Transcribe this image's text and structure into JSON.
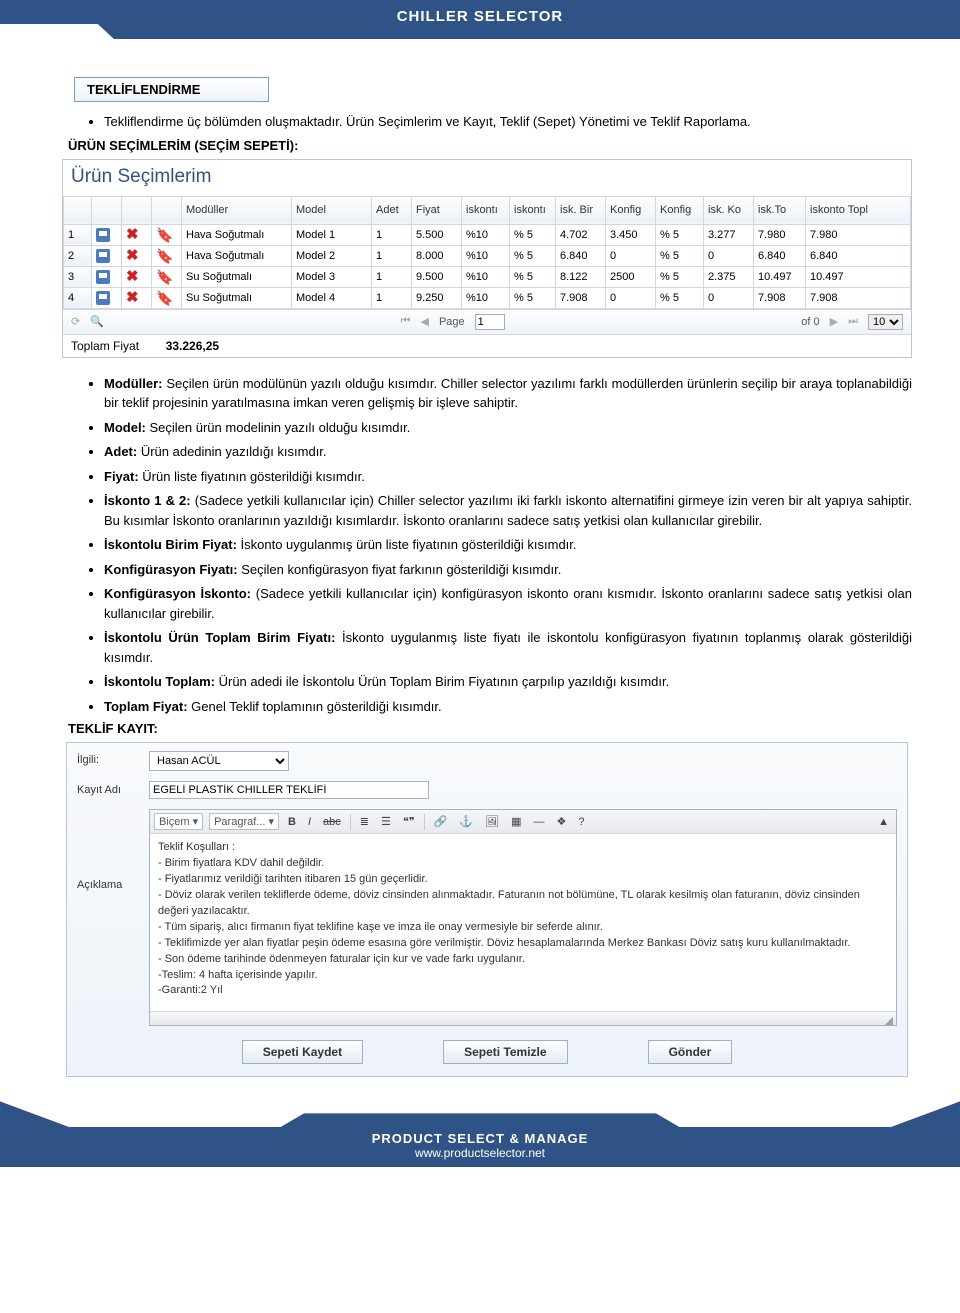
{
  "header": {
    "title": "CHILLER SELECTOR"
  },
  "section": {
    "tab_title": "TEKLİFLENDİRME",
    "intro": "Tekliflendirme üç bölümden oluşmaktadır. Ürün Seçimlerim ve Kayıt, Teklif (Sepet) Yönetimi ve Teklif Raporlama.",
    "subhead1": "ÜRÜN SEÇİMLERİM (SEÇİM SEPETİ):"
  },
  "grid": {
    "title": "Ürün Seçimlerim",
    "cols": [
      "",
      "",
      "",
      "",
      "Modüller",
      "Model",
      "Adet",
      "Fiyat",
      "iskontı",
      "iskontı",
      "isk. Bir",
      "Konfig",
      "Konfig",
      "isk. Ko",
      "isk.To",
      "iskonto Topl"
    ],
    "rows": [
      {
        "n": "1",
        "mod": "Hava Soğutmalı",
        "model": "Model 1",
        "adet": "1",
        "fiyat": "5.500",
        "i1": "%10",
        "i2": "% 5",
        "ib": "4.702",
        "kf": "3.450",
        "ki": "% 5",
        "ik": "3.277",
        "it": "7.980",
        "tot": "7.980"
      },
      {
        "n": "2",
        "mod": "Hava Soğutmalı",
        "model": "Model 2",
        "adet": "1",
        "fiyat": "8.000",
        "i1": "%10",
        "i2": "% 5",
        "ib": "6.840",
        "kf": "0",
        "ki": "% 5",
        "ik": "0",
        "it": "6.840",
        "tot": "6.840"
      },
      {
        "n": "3",
        "mod": "Su Soğutmalı",
        "model": "Model 3",
        "adet": "1",
        "fiyat": "9.500",
        "i1": "%10",
        "i2": "% 5",
        "ib": "8.122",
        "kf": "2500",
        "ki": "% 5",
        "ik": "2.375",
        "it": "10.497",
        "tot": "10.497"
      },
      {
        "n": "4",
        "mod": "Su Soğutmalı",
        "model": "Model 4",
        "adet": "1",
        "fiyat": "9.250",
        "i1": "%10",
        "i2": "% 5",
        "ib": "7.908",
        "kf": "0",
        "ki": "% 5",
        "ik": "0",
        "it": "7.908",
        "tot": "7.908"
      }
    ],
    "pager": {
      "page_lbl": "Page",
      "page": "1",
      "of_lbl": "of 0",
      "size": "10"
    },
    "total_lbl": "Toplam Fiyat",
    "total_val": "33.226,25"
  },
  "explain": [
    {
      "b": "Modüller:",
      "t": " Seçilen ürün modülünün yazılı olduğu kısımdır. Chiller selector yazılımı farklı modüllerden ürünlerin seçilip bir araya toplanabildiği bir teklif projesinin yaratılmasına imkan veren gelişmiş bir işleve sahiptir."
    },
    {
      "b": "Model:",
      "t": " Seçilen ürün modelinin yazılı olduğu kısımdır."
    },
    {
      "b": "Adet:",
      "t": " Ürün adedinin yazıldığı kısımdır."
    },
    {
      "b": "Fiyat:",
      "t": " Ürün liste fiyatının gösterildiği kısımdır."
    },
    {
      "b": "İskonto 1 & 2:",
      "t": " (Sadece yetkili kullanıcılar için) Chiller selector yazılımı iki farklı iskonto alternatifini girmeye izin veren bir alt yapıya sahiptir. Bu kısımlar İskonto oranlarının yazıldığı kısımlardır. İskonto oranlarını sadece satış yetkisi olan kullanıcılar girebilir."
    },
    {
      "b": "İskontolu Birim Fiyat:",
      "t": " İskonto uygulanmış ürün liste fiyatının gösterildiği kısımdır."
    },
    {
      "b": "Konfigürasyon Fiyatı:",
      "t": " Seçilen konfigürasyon fiyat farkının gösterildiği kısımdır."
    },
    {
      "b": "Konfigürasyon İskonto:",
      "t": " (Sadece yetkili kullanıcılar için) konfigürasyon iskonto oranı kısmıdır. İskonto oranlarını sadece satış yetkisi olan kullanıcılar girebilir."
    },
    {
      "b": "İskontolu Ürün Toplam Birim Fiyatı:",
      "t": " İskonto uygulanmış liste fiyatı ile iskontolu konfigürasyon fiyatının toplanmış olarak gösterildiği kısımdır."
    },
    {
      "b": "İskontolu Toplam:",
      "t": " Ürün adedi ile İskontolu Ürün Toplam Birim Fiyatının çarpılıp yazıldığı kısımdır."
    },
    {
      "b": "Toplam Fiyat:",
      "t": " Genel Teklif toplamının gösterildiği kısımdır."
    }
  ],
  "subhead2": "TEKLİF KAYIT:",
  "form": {
    "ilgili_lbl": "İlgili:",
    "ilgili_val": "Hasan ACÜL",
    "kayit_lbl": "Kayıt Adı",
    "kayit_val": "EGELİ PLASTİK CHILLER TEKLİFİ",
    "aciklama_lbl": "Açıklama",
    "rte_tb": {
      "bicem": "Biçem",
      "paragraf": "Paragraf..."
    },
    "rte_body": "Teklif Koşulları :\n- Birim fiyatlara KDV dahil değildir.\n- Fiyatlarımız verildiği tarihten itibaren 15 gün geçerlidir.\n- Döviz olarak verilen tekliflerde ödeme, döviz cinsinden alınmaktadır. Faturanın not bölümüne, TL olarak kesilmiş olan faturanın, döviz cinsinden\ndeğeri yazılacaktır.\n- Tüm sipariş, alıcı firmanın fiyat teklifine kaşe ve imza ile onay vermesiyle bir seferde alınır.\n- Teklifimizde yer alan fiyatlar peşin ödeme esasına göre verilmiştir. Döviz hesaplamalarında Merkez Bankası Döviz satış kuru kullanılmaktadır.\n- Son ödeme tarihinde ödenmeyen faturalar için kur ve vade farkı uygulanır.\n-Teslim: 4 hafta içerisinde yapılır.\n-Garanti:2 Yıl",
    "btn1": "Sepeti Kaydet",
    "btn2": "Sepeti Temizle",
    "btn3": "Gönder"
  },
  "footer": {
    "l1": "PRODUCT SELECT & MANAGE",
    "l2": "www.productselector.net"
  }
}
